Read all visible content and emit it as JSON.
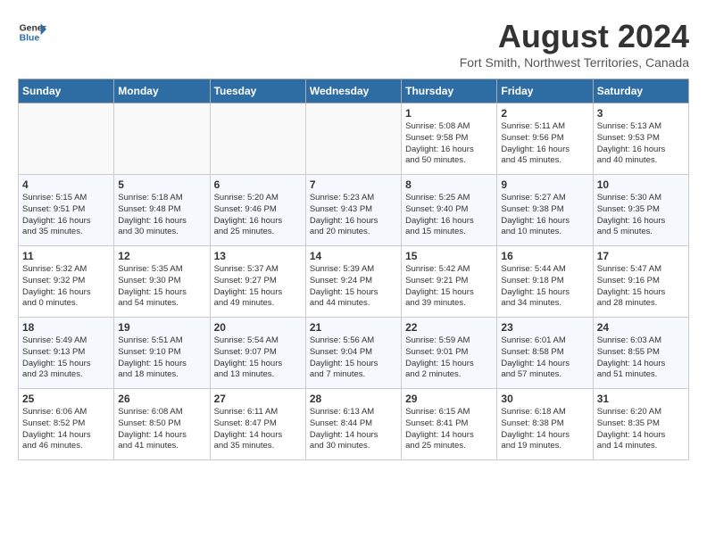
{
  "logo": {
    "line1": "General",
    "line2": "Blue"
  },
  "title": {
    "month_year": "August 2024",
    "location": "Fort Smith, Northwest Territories, Canada"
  },
  "headers": [
    "Sunday",
    "Monday",
    "Tuesday",
    "Wednesday",
    "Thursday",
    "Friday",
    "Saturday"
  ],
  "weeks": [
    [
      {
        "day": "",
        "text": ""
      },
      {
        "day": "",
        "text": ""
      },
      {
        "day": "",
        "text": ""
      },
      {
        "day": "",
        "text": ""
      },
      {
        "day": "1",
        "text": "Sunrise: 5:08 AM\nSunset: 9:58 PM\nDaylight: 16 hours\nand 50 minutes."
      },
      {
        "day": "2",
        "text": "Sunrise: 5:11 AM\nSunset: 9:56 PM\nDaylight: 16 hours\nand 45 minutes."
      },
      {
        "day": "3",
        "text": "Sunrise: 5:13 AM\nSunset: 9:53 PM\nDaylight: 16 hours\nand 40 minutes."
      }
    ],
    [
      {
        "day": "4",
        "text": "Sunrise: 5:15 AM\nSunset: 9:51 PM\nDaylight: 16 hours\nand 35 minutes."
      },
      {
        "day": "5",
        "text": "Sunrise: 5:18 AM\nSunset: 9:48 PM\nDaylight: 16 hours\nand 30 minutes."
      },
      {
        "day": "6",
        "text": "Sunrise: 5:20 AM\nSunset: 9:46 PM\nDaylight: 16 hours\nand 25 minutes."
      },
      {
        "day": "7",
        "text": "Sunrise: 5:23 AM\nSunset: 9:43 PM\nDaylight: 16 hours\nand 20 minutes."
      },
      {
        "day": "8",
        "text": "Sunrise: 5:25 AM\nSunset: 9:40 PM\nDaylight: 16 hours\nand 15 minutes."
      },
      {
        "day": "9",
        "text": "Sunrise: 5:27 AM\nSunset: 9:38 PM\nDaylight: 16 hours\nand 10 minutes."
      },
      {
        "day": "10",
        "text": "Sunrise: 5:30 AM\nSunset: 9:35 PM\nDaylight: 16 hours\nand 5 minutes."
      }
    ],
    [
      {
        "day": "11",
        "text": "Sunrise: 5:32 AM\nSunset: 9:32 PM\nDaylight: 16 hours\nand 0 minutes."
      },
      {
        "day": "12",
        "text": "Sunrise: 5:35 AM\nSunset: 9:30 PM\nDaylight: 15 hours\nand 54 minutes."
      },
      {
        "day": "13",
        "text": "Sunrise: 5:37 AM\nSunset: 9:27 PM\nDaylight: 15 hours\nand 49 minutes."
      },
      {
        "day": "14",
        "text": "Sunrise: 5:39 AM\nSunset: 9:24 PM\nDaylight: 15 hours\nand 44 minutes."
      },
      {
        "day": "15",
        "text": "Sunrise: 5:42 AM\nSunset: 9:21 PM\nDaylight: 15 hours\nand 39 minutes."
      },
      {
        "day": "16",
        "text": "Sunrise: 5:44 AM\nSunset: 9:18 PM\nDaylight: 15 hours\nand 34 minutes."
      },
      {
        "day": "17",
        "text": "Sunrise: 5:47 AM\nSunset: 9:16 PM\nDaylight: 15 hours\nand 28 minutes."
      }
    ],
    [
      {
        "day": "18",
        "text": "Sunrise: 5:49 AM\nSunset: 9:13 PM\nDaylight: 15 hours\nand 23 minutes."
      },
      {
        "day": "19",
        "text": "Sunrise: 5:51 AM\nSunset: 9:10 PM\nDaylight: 15 hours\nand 18 minutes."
      },
      {
        "day": "20",
        "text": "Sunrise: 5:54 AM\nSunset: 9:07 PM\nDaylight: 15 hours\nand 13 minutes."
      },
      {
        "day": "21",
        "text": "Sunrise: 5:56 AM\nSunset: 9:04 PM\nDaylight: 15 hours\nand 7 minutes."
      },
      {
        "day": "22",
        "text": "Sunrise: 5:59 AM\nSunset: 9:01 PM\nDaylight: 15 hours\nand 2 minutes."
      },
      {
        "day": "23",
        "text": "Sunrise: 6:01 AM\nSunset: 8:58 PM\nDaylight: 14 hours\nand 57 minutes."
      },
      {
        "day": "24",
        "text": "Sunrise: 6:03 AM\nSunset: 8:55 PM\nDaylight: 14 hours\nand 51 minutes."
      }
    ],
    [
      {
        "day": "25",
        "text": "Sunrise: 6:06 AM\nSunset: 8:52 PM\nDaylight: 14 hours\nand 46 minutes."
      },
      {
        "day": "26",
        "text": "Sunrise: 6:08 AM\nSunset: 8:50 PM\nDaylight: 14 hours\nand 41 minutes."
      },
      {
        "day": "27",
        "text": "Sunrise: 6:11 AM\nSunset: 8:47 PM\nDaylight: 14 hours\nand 35 minutes."
      },
      {
        "day": "28",
        "text": "Sunrise: 6:13 AM\nSunset: 8:44 PM\nDaylight: 14 hours\nand 30 minutes."
      },
      {
        "day": "29",
        "text": "Sunrise: 6:15 AM\nSunset: 8:41 PM\nDaylight: 14 hours\nand 25 minutes."
      },
      {
        "day": "30",
        "text": "Sunrise: 6:18 AM\nSunset: 8:38 PM\nDaylight: 14 hours\nand 19 minutes."
      },
      {
        "day": "31",
        "text": "Sunrise: 6:20 AM\nSunset: 8:35 PM\nDaylight: 14 hours\nand 14 minutes."
      }
    ]
  ]
}
